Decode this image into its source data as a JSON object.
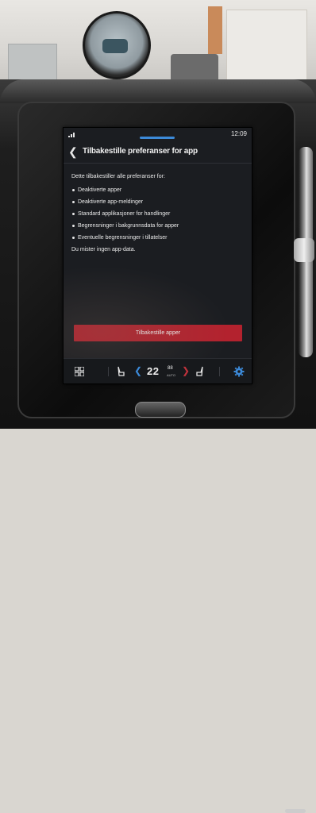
{
  "status": {
    "clock": "12:09"
  },
  "header": {
    "title": "Tilbakestille preferanser for app"
  },
  "content": {
    "intro": "Dette tilbakestiller alle preferanser for:",
    "bullets": [
      "Deaktiverte apper",
      "Deaktiverte app-meldinger",
      "Standard applikasjoner for handlinger",
      "Begrensninger i bakgrunnsdata for apper",
      "Eventuelle begrensninger i tillatelser"
    ],
    "footer": "Du mister ingen app-data."
  },
  "actions": {
    "reset_label": "Tilbakestille apper"
  },
  "climate": {
    "temperature": "22",
    "temperature_decimal": "88",
    "mode": "AUTO"
  },
  "colors": {
    "accent_blue": "#3c8ad9",
    "primary_red": "#b3222e",
    "screen_bg": "#1b1d21"
  },
  "icons": {
    "back": "chevron-left-icon",
    "apps": "apps-grid-icon",
    "seat_left": "seat-heat-icon",
    "seat_right": "seat-heat-icon",
    "temp_down": "chevron-left-icon",
    "temp_up": "chevron-right-icon",
    "settings": "gear-icon"
  }
}
